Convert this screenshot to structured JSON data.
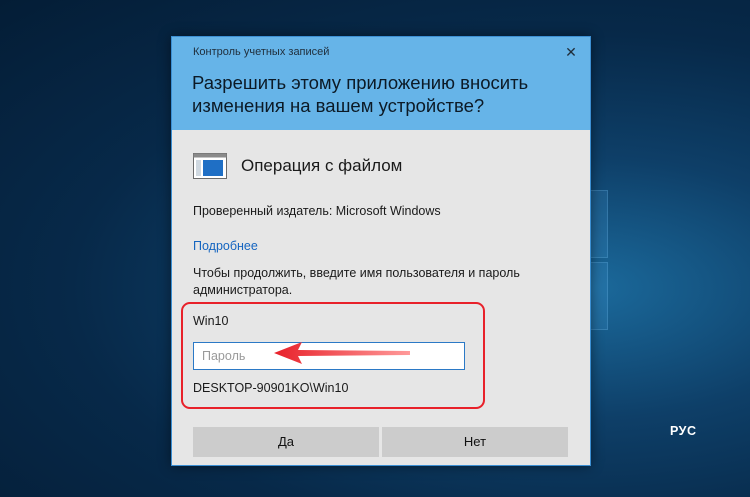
{
  "window": {
    "title": "Контроль учетных записей",
    "close_icon": "close-icon"
  },
  "header": {
    "question": "Разрешить этому приложению вносить изменения на вашем устройстве?"
  },
  "app": {
    "icon": "file-operation-icon",
    "name": "Операция с файлом"
  },
  "publisher": {
    "text": "Проверенный издатель: Microsoft Windows"
  },
  "details_link": "Подробнее",
  "instruction": "Чтобы продолжить, введите имя пользователя и пароль администратора.",
  "credentials": {
    "username": "Win10",
    "password_placeholder": "Пароль",
    "password_value": "",
    "domain": "DESKTOP-90901KO\\Win10"
  },
  "buttons": {
    "yes_label": "Да",
    "no_label": "Нет"
  },
  "taskbar": {
    "language": "РУС"
  },
  "colors": {
    "header_bg": "#66b4e8",
    "dialog_bg": "#e6e6e6",
    "link": "#1565c0",
    "annotation_red": "#e8212a",
    "input_border": "#2b79c6"
  }
}
